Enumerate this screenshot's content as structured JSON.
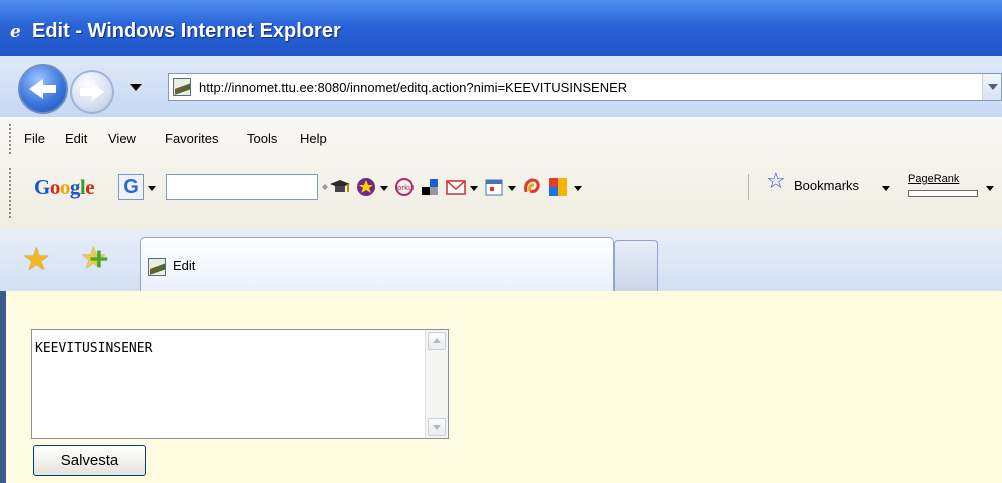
{
  "window": {
    "title": "Edit - Windows Internet Explorer"
  },
  "address": {
    "url": "http://innomet.ttu.ee:8080/innomet/editq.action?nimi=KEEVITUSINSENER"
  },
  "menu": [
    "File",
    "Edit",
    "View",
    "Favorites",
    "Tools",
    "Help"
  ],
  "google_toolbar": {
    "logo": [
      "G",
      "o",
      "o",
      "g",
      "l",
      "e"
    ],
    "g_button": "G",
    "search_value": "",
    "bookmarks_label": "Bookmarks",
    "pagerank_label": "PageRank"
  },
  "tabs": [
    {
      "label": "Edit",
      "active": true
    }
  ],
  "form": {
    "textarea_value": "KEEVITUSINSENER",
    "save_label": "Salvesta"
  },
  "colors": {
    "titlebar": "#2a64d8",
    "content_bg": "#fffce1"
  }
}
